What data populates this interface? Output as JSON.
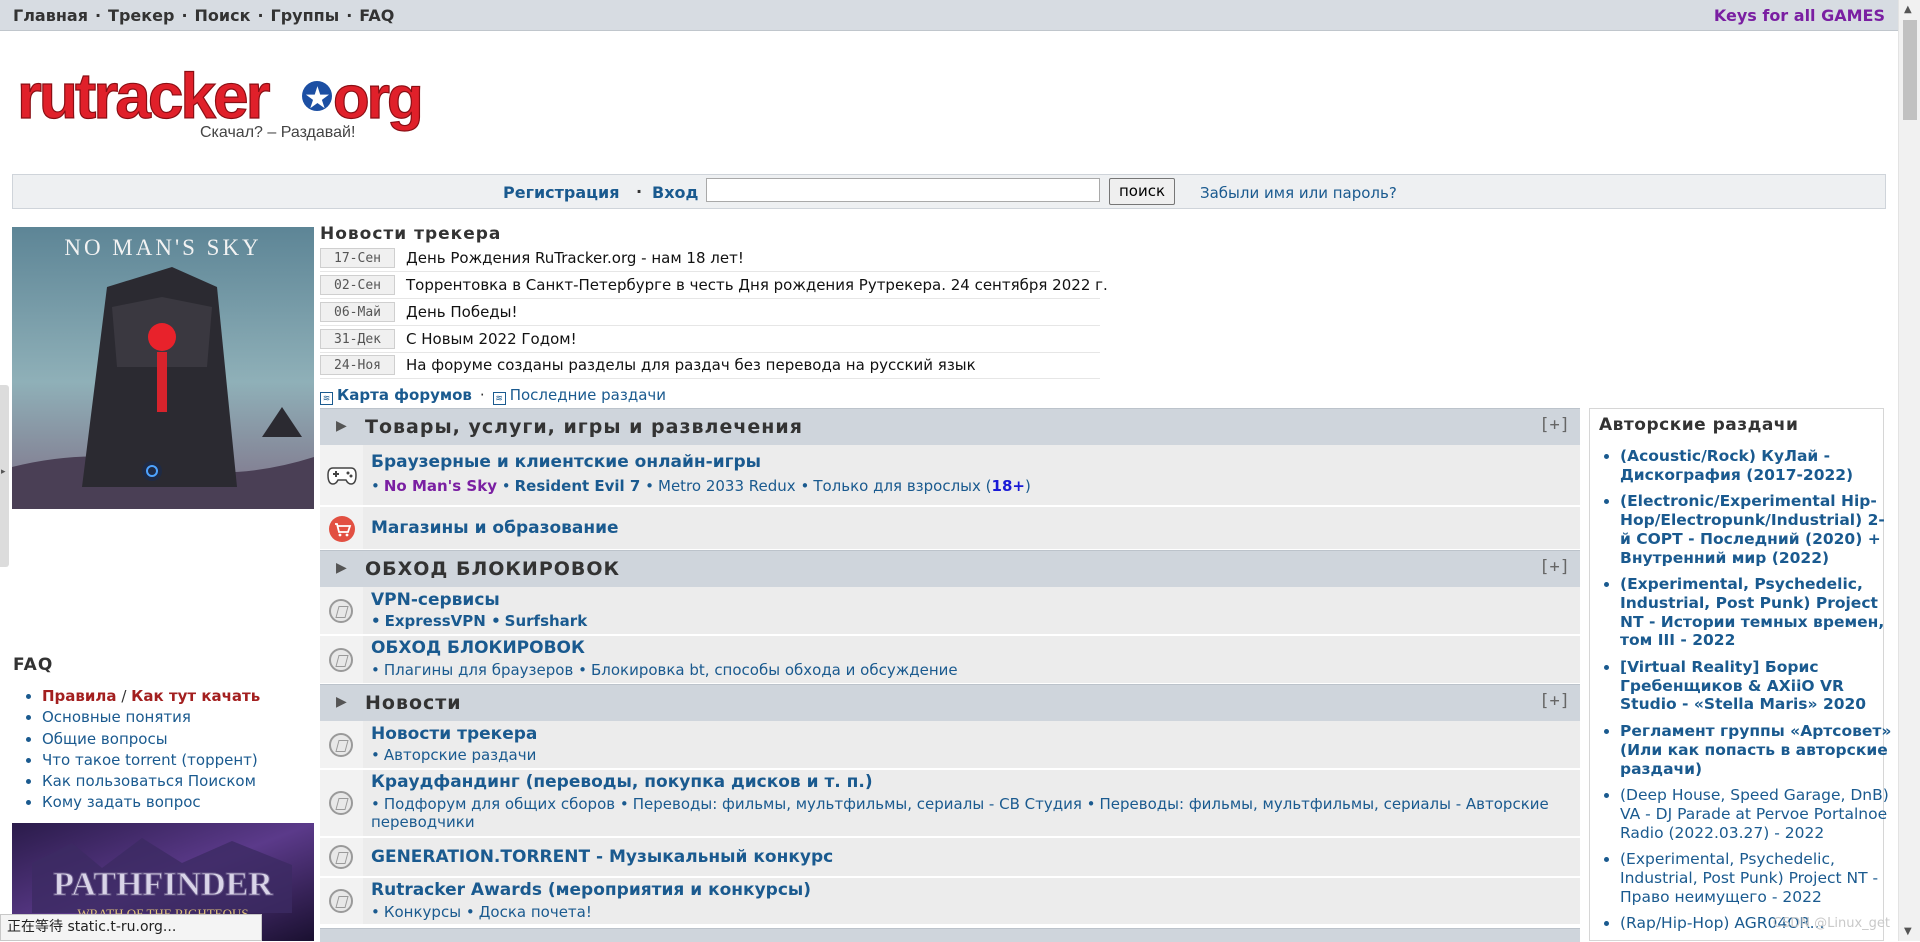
{
  "topnav": {
    "links": [
      "Главная",
      "Трекер",
      "Поиск",
      "Группы",
      "FAQ"
    ],
    "right_link": "Keys for all GAMES"
  },
  "logo": {
    "brand": "rutracker.org",
    "slogan": "Скачал? – Раздавай!"
  },
  "login": {
    "register": "Регистрация",
    "login": "Вход",
    "search_value": "",
    "search_button": "поиск",
    "forgot": "Забыли имя или пароль?"
  },
  "banner_top": {
    "title": "NO MAN'S SKY"
  },
  "news": {
    "title": "Новости трекера",
    "items": [
      {
        "date": "17-Сен",
        "text": "День Рождения RuTracker.org - нам 18 лет!"
      },
      {
        "date": "02-Сен",
        "text": "Торрентовка в Санкт-Петербурге в честь Дня рождения Рутрекера. 24 сентября 2022 г."
      },
      {
        "date": "06-Май",
        "text": "День Победы!"
      },
      {
        "date": "31-Дек",
        "text": "С Новым 2022 Годом!"
      },
      {
        "date": "24-Ноя",
        "text": "На форуме созданы разделы для раздач без перевода на русский язык"
      }
    ],
    "forum_map": "Карта форумов",
    "latest": "Последние раздачи"
  },
  "categories": [
    {
      "title": "Товары, услуги, игры и развлечения",
      "toggle": "[+]",
      "forums": [
        {
          "name": "Браузерные и клиентские онлайн-игры",
          "subs": [
            "No Man's Sky",
            "Resident Evil 7",
            "Metro 2033 Redux",
            "Только для взрослых (",
            "18+",
            ")"
          ]
        },
        {
          "name": "Магазины и образование"
        }
      ]
    },
    {
      "title": "ОБХОД БЛОКИРОВОК",
      "toggle": "[+]",
      "forums": [
        {
          "name": "VPN-сервисы",
          "subs": [
            "ExpressVPN",
            "Surfshark"
          ]
        },
        {
          "name": "ОБХОД БЛОКИРОВОК",
          "subs": [
            "Плагины для браузеров",
            "Блокировка bt, способы обхода и обсуждение"
          ]
        }
      ]
    },
    {
      "title": "Новости",
      "toggle": "[+]",
      "forums": [
        {
          "name": "Новости трекера",
          "subs": [
            "Авторские раздачи"
          ]
        },
        {
          "name": "Краудфандинг (переводы, покупка дисков и т. п.)",
          "subs": [
            "Подфорум для общих сборов",
            "Переводы: фильмы, мультфильмы, сериалы - СВ Студия",
            "Переводы: фильмы, мультфильмы, сериалы - Авторские переводчики"
          ]
        },
        {
          "name": "GENERATION.TORRENT - Музыкальный конкурс"
        },
        {
          "name": "Rutracker Awards (мероприятия и конкурсы)",
          "subs": [
            "Конкурсы",
            "Доска почета!"
          ]
        }
      ]
    }
  ],
  "faq": {
    "title": "FAQ",
    "rules": "Правила",
    "slash": "/",
    "howto": "Как тут качать",
    "items": [
      "Основные понятия",
      "Общие вопросы",
      "Что такое torrent (торрент)",
      "Как пользоваться Поиском",
      "Кому задать вопрос"
    ]
  },
  "banner_bottom": {
    "title": "PATHFINDER",
    "subtitle": "WRATH OF THE RIGHTEOUS"
  },
  "authors": {
    "title": "Авторские раздачи",
    "items": [
      {
        "text": "(Acoustic/Rock) КуЛай - Дискография (2017-2022)",
        "bold": true
      },
      {
        "text": "(Electronic/Experimental Hip-Hop/Electropunk/Industrial) 2-й СОРТ - Последний (2020) + Внутренний мир (2022)",
        "bold": true
      },
      {
        "text": "(Experimental, Psychedelic, Industrial, Post Punk) Project NT - Истории темных времен, том III - 2022",
        "bold": true
      },
      {
        "text": "[Virtual Reality] Борис Гребенщиков & AXiiO VR Studio - «Stella Maris» 2020",
        "bold": true
      },
      {
        "text": "Регламент группы «Артсовет» (Или как попасть в авторские раздачи)",
        "bold": true
      },
      {
        "text": "(Deep House, Speed Garage, DnB) VA - DJ Parade at Pervoe Portalnoe Radio (2022.03.27) - 2022",
        "bold": false
      },
      {
        "text": "(Experimental, Psychedelic, Industrial, Post Punk) Project NT - Право неимущего - 2022",
        "bold": false
      },
      {
        "text": "(Rap/Hip-Hop) AGR04OR...",
        "bold": false
      }
    ]
  },
  "status": {
    "text": "正在等待 static.t-ru.org...",
    "watermark": "CSDN @Linux_get"
  },
  "colors": {
    "link": "#1a5a8f",
    "header_bg": "#cfd5dc",
    "accent_red": "#a31f1f",
    "keys_purple": "#7a1fa2"
  }
}
